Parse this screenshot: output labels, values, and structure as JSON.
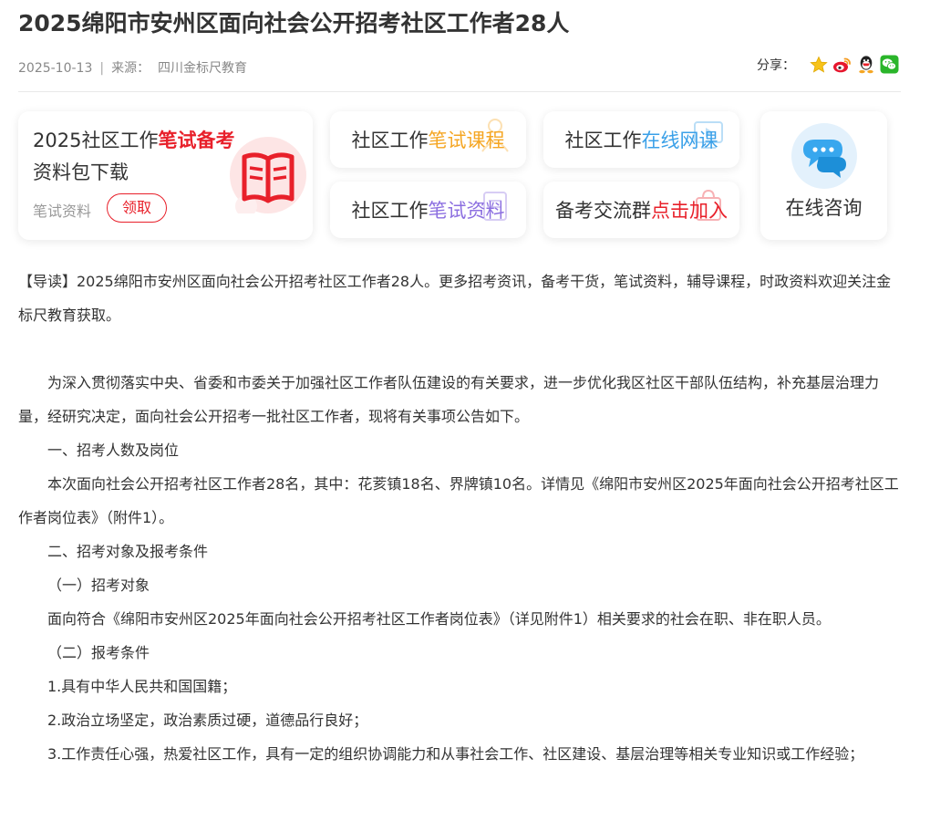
{
  "header": {
    "title": "2025绵阳市安州区面向社会公开招考社区工作者28人",
    "date": "2025-10-13",
    "source_label": "来源：",
    "source": "四川金标尺教育",
    "share_label": "分享："
  },
  "share_icons": [
    "star-icon",
    "weibo-icon",
    "qq-icon",
    "wechat-icon"
  ],
  "promo": {
    "big": {
      "line1_a": "2025社区工作",
      "line1_b": "笔试备考",
      "line2": "资料包下载",
      "sub": "笔试资料",
      "button": "领取"
    },
    "tiles": [
      {
        "a": "社区工作",
        "b": "笔试课程"
      },
      {
        "a": "社区工作",
        "b": "在线网课"
      },
      {
        "a": "社区工作",
        "b": "笔试资料"
      },
      {
        "a": "备考交流群",
        "b": "点击加入"
      }
    ],
    "consult": "在线咨询"
  },
  "colors": {
    "accent_red": "#e8202a",
    "orange": "#f5a623",
    "blue": "#3aa0e8",
    "purple": "#8c6fe0"
  },
  "article": {
    "intro": "【导读】2025绵阳市安州区面向社会公开招考社区工作者28人。更多招考资讯，备考干货，笔试资料，辅导课程，时政资料欢迎关注金标尺教育获取。",
    "p1": "为深入贯彻落实中央、省委和市委关于加强社区工作者队伍建设的有关要求，进一步优化我区社区干部队伍结构，补充基层治理力量，经研究决定，面向社会公开招考一批社区工作者，现将有关事项公告如下。",
    "h1": "一、招考人数及岗位",
    "p2": "本次面向社会公开招考社区工作者28名，其中：花荄镇18名、界牌镇10名。详情见《绵阳市安州区2025年面向社会公开招考社区工作者岗位表》（附件1）。",
    "h2": "二、招考对象及报考条件",
    "h2a": "（一）招考对象",
    "p3": "面向符合《绵阳市安州区2025年面向社会公开招考社区工作者岗位表》（详见附件1）相关要求的社会在职、非在职人员。",
    "h2b": "（二）报考条件",
    "c1": "1.具有中华人民共和国国籍；",
    "c2": "2.政治立场坚定，政治素质过硬，道德品行良好；",
    "c3": "3.工作责任心强，热爱社区工作，具有一定的组织协调能力和从事社会工作、社区建设、基层治理等相关专业知识或工作经验；"
  }
}
